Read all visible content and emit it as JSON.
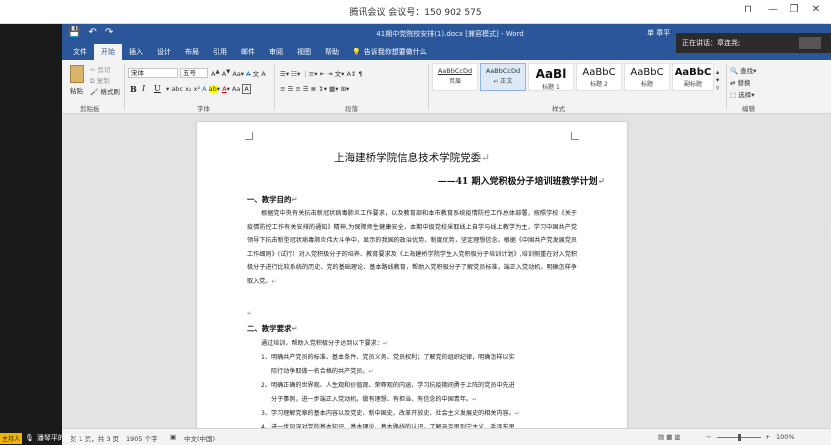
{
  "meeting": {
    "title": "腾讯会议 会议号：150 902 575",
    "pin": "⊓",
    "minimize": "—",
    "restore": "❐",
    "close": "✕"
  },
  "word": {
    "doc_title": "41期中党院校安排(1).docx [兼容模式] - Word",
    "share_user": "单 章平",
    "qat": {
      "save": "💾",
      "undo": "↶",
      "redo": "↷"
    },
    "tabs": [
      "文件",
      "开始",
      "插入",
      "设计",
      "布局",
      "引用",
      "邮件",
      "审阅",
      "视图",
      "帮助"
    ],
    "tell_me": "告诉我你想要做什么",
    "ribbon": {
      "paste": "粘贴",
      "cut": "剪切",
      "copy": "复制",
      "format_painter": "格式刷",
      "clipboard": "剪贴板",
      "font_name": "宋体",
      "font_size": "五号",
      "font_group": "字体",
      "paragraph_group": "段落",
      "styles_group": "样式",
      "editing_group": "编辑",
      "find": "查找",
      "replace": "替换",
      "select": "选择",
      "bold": "B",
      "italic": "I",
      "underline": "U",
      "styles": [
        {
          "sample": "AaBbCcDd",
          "name": "页眉"
        },
        {
          "sample": "AaBbCcDd",
          "name": "↵ 正文"
        },
        {
          "sample": "AaBl",
          "name": "标题 1"
        },
        {
          "sample": "AaBbC",
          "name": "标题 2"
        },
        {
          "sample": "AaBbC",
          "name": "标题"
        },
        {
          "sample": "AaBbC",
          "name": "副标题"
        }
      ]
    },
    "page": {
      "org": "上海建桥学院信息技术学院党委",
      "plan": "——41 期入党积极分子培训班教学计划",
      "h1": "一、教学目的",
      "p1": "根据党中央有关抗击新冠状病毒肺炎工作要求，以及教育部和本市教育系统疫情防控工作总体部署，按照学校《关于疫情防控工作有关安排的通知》精神,为保障师生健康安全，本期中级党校采取线上自学与线上教学为主，学习中国共产党领导下抗击新型冠状病毒肺炎伟大斗争中，显示的我国的政治优势、制度优势，坚定理想信念。根据《中国共产党发展党员工作细则》(试行）对入党积极分子的培养、教育要求及《上海建桥学院学生入党积极分子培训计划》,培训侧重在对入党积极分子进行比较系统的历史、党的基础理论、基本路线教育，帮助入党积极分子了解党员标准，端正入党动机，明确怎样争取入党。",
      "h2": "二、教学要求",
      "intro": "通过培训，帮助入党积极分子达到以下要求：",
      "items": [
        "1、明确共产党员的标准、基本条件、党员义务、党员权利；了解党的组织纪律，明确怎样以实",
        "际行动争取做一名合格的共产党员。",
        "2、明确正确的世界观、人生观和价值观、荣辱观的内涵，学习抗疫期间勇于上阵的党员中先进",
        "分子事例，进一步端正入党动机，做有理想、有担当、有信念的中国青年。",
        "3、学习理解党章的基本内容以及党史、新中国史、改革开放史、社会主义发展史的相关内容。",
        "4、进一步加深对党的基本知识、基本理论、基本路线的认识，了解马克思列宁主义、毛泽东思"
      ]
    },
    "status": {
      "page": "第 1 页，共 3 页",
      "words": "1905 个字",
      "lang": "中文(中国)",
      "zoom": "100%",
      "minus": "−",
      "plus": "+"
    }
  },
  "side_panel": {
    "speaking": "正在讲话：章连尧;"
  },
  "presenter": {
    "badge": "主持人",
    "text": "潘琴平的屏幕共享"
  }
}
